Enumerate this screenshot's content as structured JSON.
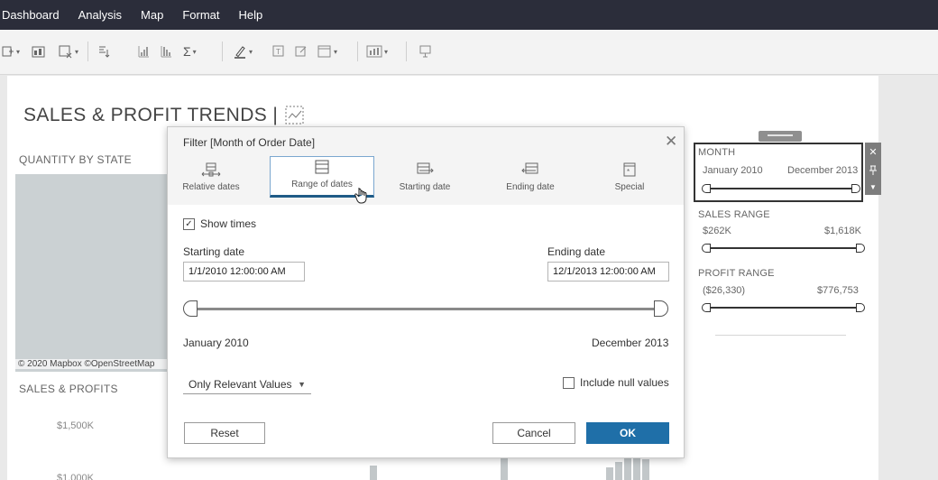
{
  "menu": [
    "Dashboard",
    "Analysis",
    "Map",
    "Format",
    "Help"
  ],
  "dashboard": {
    "title": "SALES & PROFIT TRENDS |",
    "map_section": "QUANTITY BY STATE",
    "map_credit": "© 2020 Mapbox ©OpenStreetMap",
    "chart_section": "SALES & PROFITS",
    "y_ticks": [
      "$1,500K",
      "$1,000K"
    ]
  },
  "right_pane": {
    "month": {
      "label": "MONTH",
      "start": "January 2010",
      "end": "December 2013"
    },
    "sales": {
      "label": "SALES RANGE",
      "min": "$262K",
      "max": "$1,618K"
    },
    "profit": {
      "label": "PROFIT RANGE",
      "min": "($26,330)",
      "max": "$776,753"
    },
    "close_glyph": "✕"
  },
  "dialog": {
    "title": "Filter [Month of Order Date]",
    "close_glyph": "✕",
    "tabs": [
      {
        "label": "Relative dates",
        "active": false
      },
      {
        "label": "Range of dates",
        "active": true
      },
      {
        "label": "Starting date",
        "active": false
      },
      {
        "label": "Ending date",
        "active": false
      },
      {
        "label": "Special",
        "active": false
      }
    ],
    "show_times": {
      "label": "Show times",
      "checked": true
    },
    "starting_date": {
      "label": "Starting date",
      "value": "1/1/2010 12:00:00 AM"
    },
    "ending_date": {
      "label": "Ending date",
      "value": "12/1/2013 12:00:00 AM"
    },
    "range_start": "January 2010",
    "range_end": "December 2013",
    "values_dropdown": "Only Relevant Values",
    "include_null": {
      "label": "Include null values",
      "checked": false
    },
    "buttons": {
      "reset": "Reset",
      "cancel": "Cancel",
      "ok": "OK"
    }
  },
  "colors": {
    "menubar": "#2b2d3a",
    "primary": "#1f6fa8",
    "active_tab_border": "#1f5b87"
  }
}
